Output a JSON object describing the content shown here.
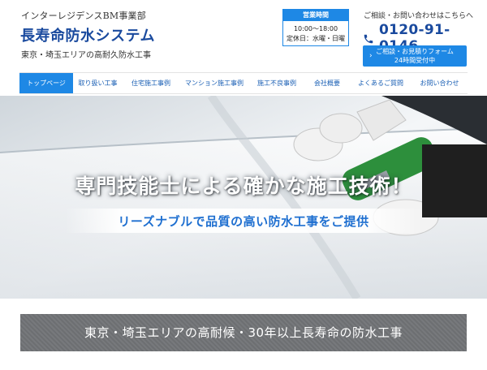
{
  "header": {
    "company": "インターレジデンスBM事業部",
    "logo": "長寿命防水システム",
    "area": "東京・埼玉エリアの高耐久防水工事",
    "hours": {
      "title": "営業時間",
      "time": "10:00～18:00",
      "closed": "定休日：水曜・日曜"
    },
    "contact_label": "ご相談・お問い合わせはこちらへ",
    "phone": "0120-91-0146",
    "form_button": {
      "line1": "ご相談・お見積りフォーム",
      "line2": "24時間受付中"
    }
  },
  "nav": {
    "items": [
      {
        "label": "トップページ"
      },
      {
        "label": "取り扱い工事"
      },
      {
        "label": "住宅施工事例"
      },
      {
        "label": "マンション施工事例"
      },
      {
        "label": "施工不良事例"
      },
      {
        "label": "会社概要"
      },
      {
        "label": "よくあるご質問"
      },
      {
        "label": "お問い合わせ"
      }
    ],
    "active_index": 0
  },
  "hero": {
    "title": "専門技能士による確かな施工技術！",
    "subtitle": "リーズナブルで品質の高い防水工事をご提供"
  },
  "banner": {
    "text": "東京・埼玉エリアの高耐候・30年以上長寿命の防水工事"
  },
  "colors": {
    "brand_blue": "#1a4a9e",
    "accent_blue": "#1e88e5",
    "banner_gray": "#6d6f72"
  },
  "icons": {
    "phone": "phone-icon",
    "form_chevron": "chevron-right-icon"
  }
}
